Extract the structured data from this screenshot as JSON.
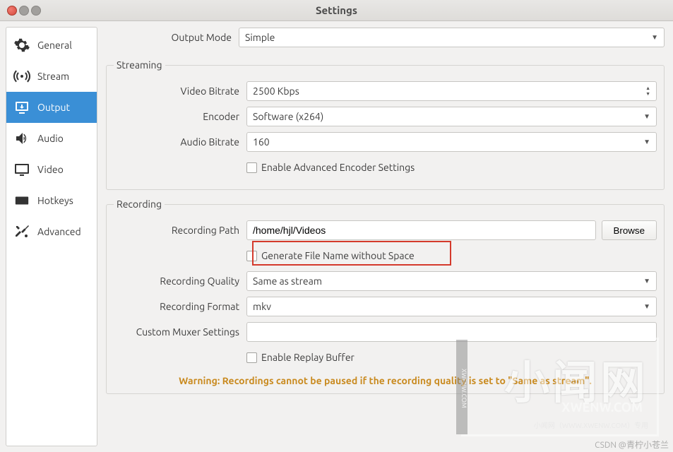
{
  "title": "Settings",
  "sidebar": {
    "items": [
      {
        "label": "General"
      },
      {
        "label": "Stream"
      },
      {
        "label": "Output"
      },
      {
        "label": "Audio"
      },
      {
        "label": "Video"
      },
      {
        "label": "Hotkeys"
      },
      {
        "label": "Advanced"
      }
    ]
  },
  "output": {
    "mode_label": "Output Mode",
    "mode_value": "Simple",
    "streaming": {
      "legend": "Streaming",
      "video_bitrate_label": "Video Bitrate",
      "video_bitrate_value": "2500 Kbps",
      "encoder_label": "Encoder",
      "encoder_value": "Software (x264)",
      "audio_bitrate_label": "Audio Bitrate",
      "audio_bitrate_value": "160",
      "enable_advanced": "Enable Advanced Encoder Settings"
    },
    "recording": {
      "legend": "Recording",
      "path_label": "Recording Path",
      "path_value": "/home/hjl/Videos",
      "browse": "Browse",
      "no_space": "Generate File Name without Space",
      "quality_label": "Recording Quality",
      "quality_value": "Same as stream",
      "format_label": "Recording Format",
      "format_value": "mkv",
      "muxer_label": "Custom Muxer Settings",
      "muxer_value": "",
      "replay": "Enable Replay Buffer"
    },
    "warning": "Warning: Recordings cannot be paused if the recording quality is set to \"Same as stream\"."
  },
  "watermark": {
    "big": "小闻网",
    "en": "XWENW.COM",
    "small": "小闻网（WWW.XWENW.COM）专用",
    "side": "XWENW.COM",
    "csdn": "CSDN @青柠小苍兰"
  }
}
